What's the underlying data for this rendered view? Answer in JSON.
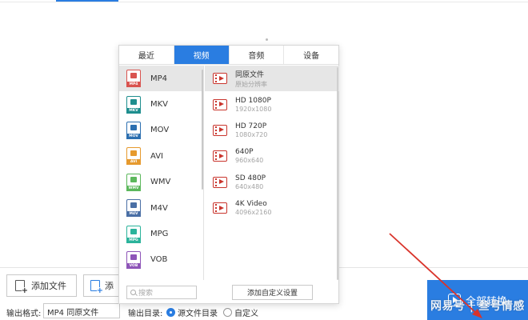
{
  "popup": {
    "tabs": [
      {
        "label": "最近"
      },
      {
        "label": "视频"
      },
      {
        "label": "音频"
      },
      {
        "label": "设备"
      }
    ],
    "formats": [
      {
        "label": "MP4",
        "tag": "MP4",
        "color": "#d9534f"
      },
      {
        "label": "MKV",
        "tag": "MKV",
        "color": "#1e8e8e"
      },
      {
        "label": "MOV",
        "tag": "MOV",
        "color": "#2c6fb0"
      },
      {
        "label": "AVI",
        "tag": "AVI",
        "color": "#e69a2e"
      },
      {
        "label": "WMV",
        "tag": "WMV",
        "color": "#5cb85c"
      },
      {
        "label": "M4V",
        "tag": "M4V",
        "color": "#4a6fa5"
      },
      {
        "label": "MPG",
        "tag": "MPG",
        "color": "#2bb39b"
      },
      {
        "label": "VOB",
        "tag": "VOB",
        "color": "#8e55b8"
      }
    ],
    "resolutions": [
      {
        "name": "同原文件",
        "sub": "原始分辨率"
      },
      {
        "name": "HD 1080P",
        "sub": "1920x1080"
      },
      {
        "name": "HD 720P",
        "sub": "1080x720"
      },
      {
        "name": "640P",
        "sub": "960x640"
      },
      {
        "name": "SD 480P",
        "sub": "640x480"
      },
      {
        "name": "4K Video",
        "sub": "4096x2160"
      }
    ],
    "search_placeholder": "搜索",
    "custom_button": "添加自定义设置"
  },
  "toolbar": {
    "add_file": "添加文件",
    "add_folder": "添",
    "output_format_label": "输出格式:",
    "output_format_value": "MP4 同原文件",
    "output_dir_label": "输出目录:",
    "dir_option_source": "源文件目录",
    "dir_option_custom": "自定义",
    "convert_all": "全部转换"
  },
  "watermark": "网易号 | 叁号情感",
  "colors": {
    "accent": "#2a7de1",
    "film_icon": "#c9352d"
  }
}
